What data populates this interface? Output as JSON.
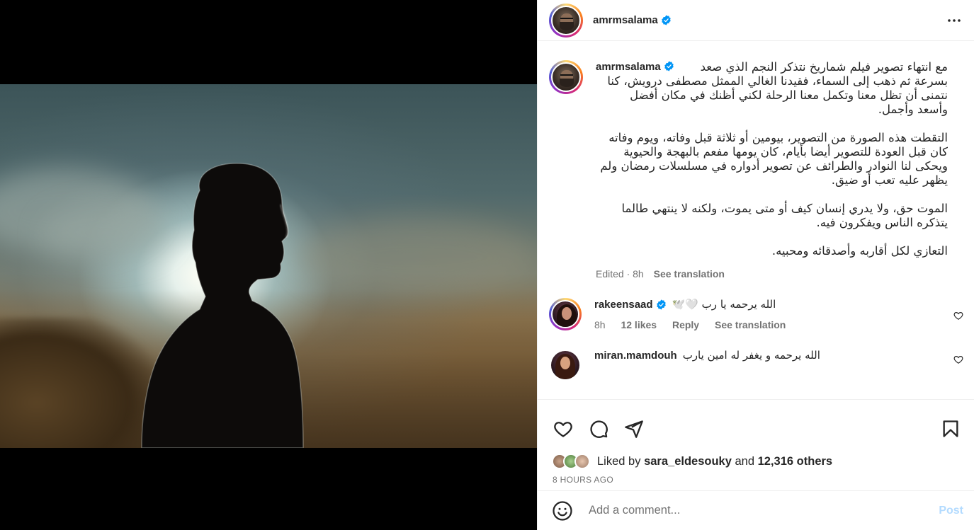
{
  "post": {
    "author": "amrmsalama",
    "more_icon": "more-horizontal-icon",
    "caption_paragraphs": [
      "مع انتهاء تصوير فيلم شماريخ نتذكر النجم الذي صعد بسرعة ثم ذهب إلى السماء، فقيدنا الغالي الممثل مصطفى درويش، كنا نتمنى أن تظل معنا وتكمل معنا الرحلة لكني أظنك في مكان أفضل وأسعد وأجمل.",
      "التقطت هذه الصورة من التصوير، بيومين أو ثلاثة قبل وفاته، ويوم وفاته كان قبل العودة للتصوير أيضا بأيام، كان يومها مفعم بالبهجة والحيوية ويحكى لنا النوادر والطرائف عن تصوير أدواره في مسلسلات رمضان ولم يظهر عليه تعب أو ضيق.",
      "الموت حق، ولا يدري إنسان كيف أو متى يموت، ولكنه لا ينتهي طالما يتذكره الناس ويفكرون فيه.",
      "التعازي لكل أقاربه وأصدقائه ومحبيه."
    ],
    "caption_meta": {
      "edited": "Edited · 8h",
      "see_translation": "See translation"
    }
  },
  "comments": [
    {
      "user": "rakeensaad",
      "text": "الله يرحمه يا رب 🤍🕊️",
      "time": "8h",
      "likes": "12 likes",
      "reply": "Reply",
      "see_translation": "See translation"
    },
    {
      "user": "miran.mamdouh",
      "text": "الله يرحمه و يغفر له امين يارب"
    }
  ],
  "actions": {
    "like_icon": "heart-icon",
    "comment_icon": "comment-icon",
    "share_icon": "share-icon",
    "save_icon": "bookmark-icon"
  },
  "likes": {
    "prefix": "Liked by",
    "user": "sara_eldesouky",
    "and": "and",
    "others": "12,316 others"
  },
  "timestamp": "8 HOURS AGO",
  "add_comment": {
    "placeholder": "Add a comment...",
    "post_label": "Post"
  },
  "colors": {
    "verified": "#0095f6",
    "post_disabled": "#b3dbff",
    "muted": "#737373"
  }
}
